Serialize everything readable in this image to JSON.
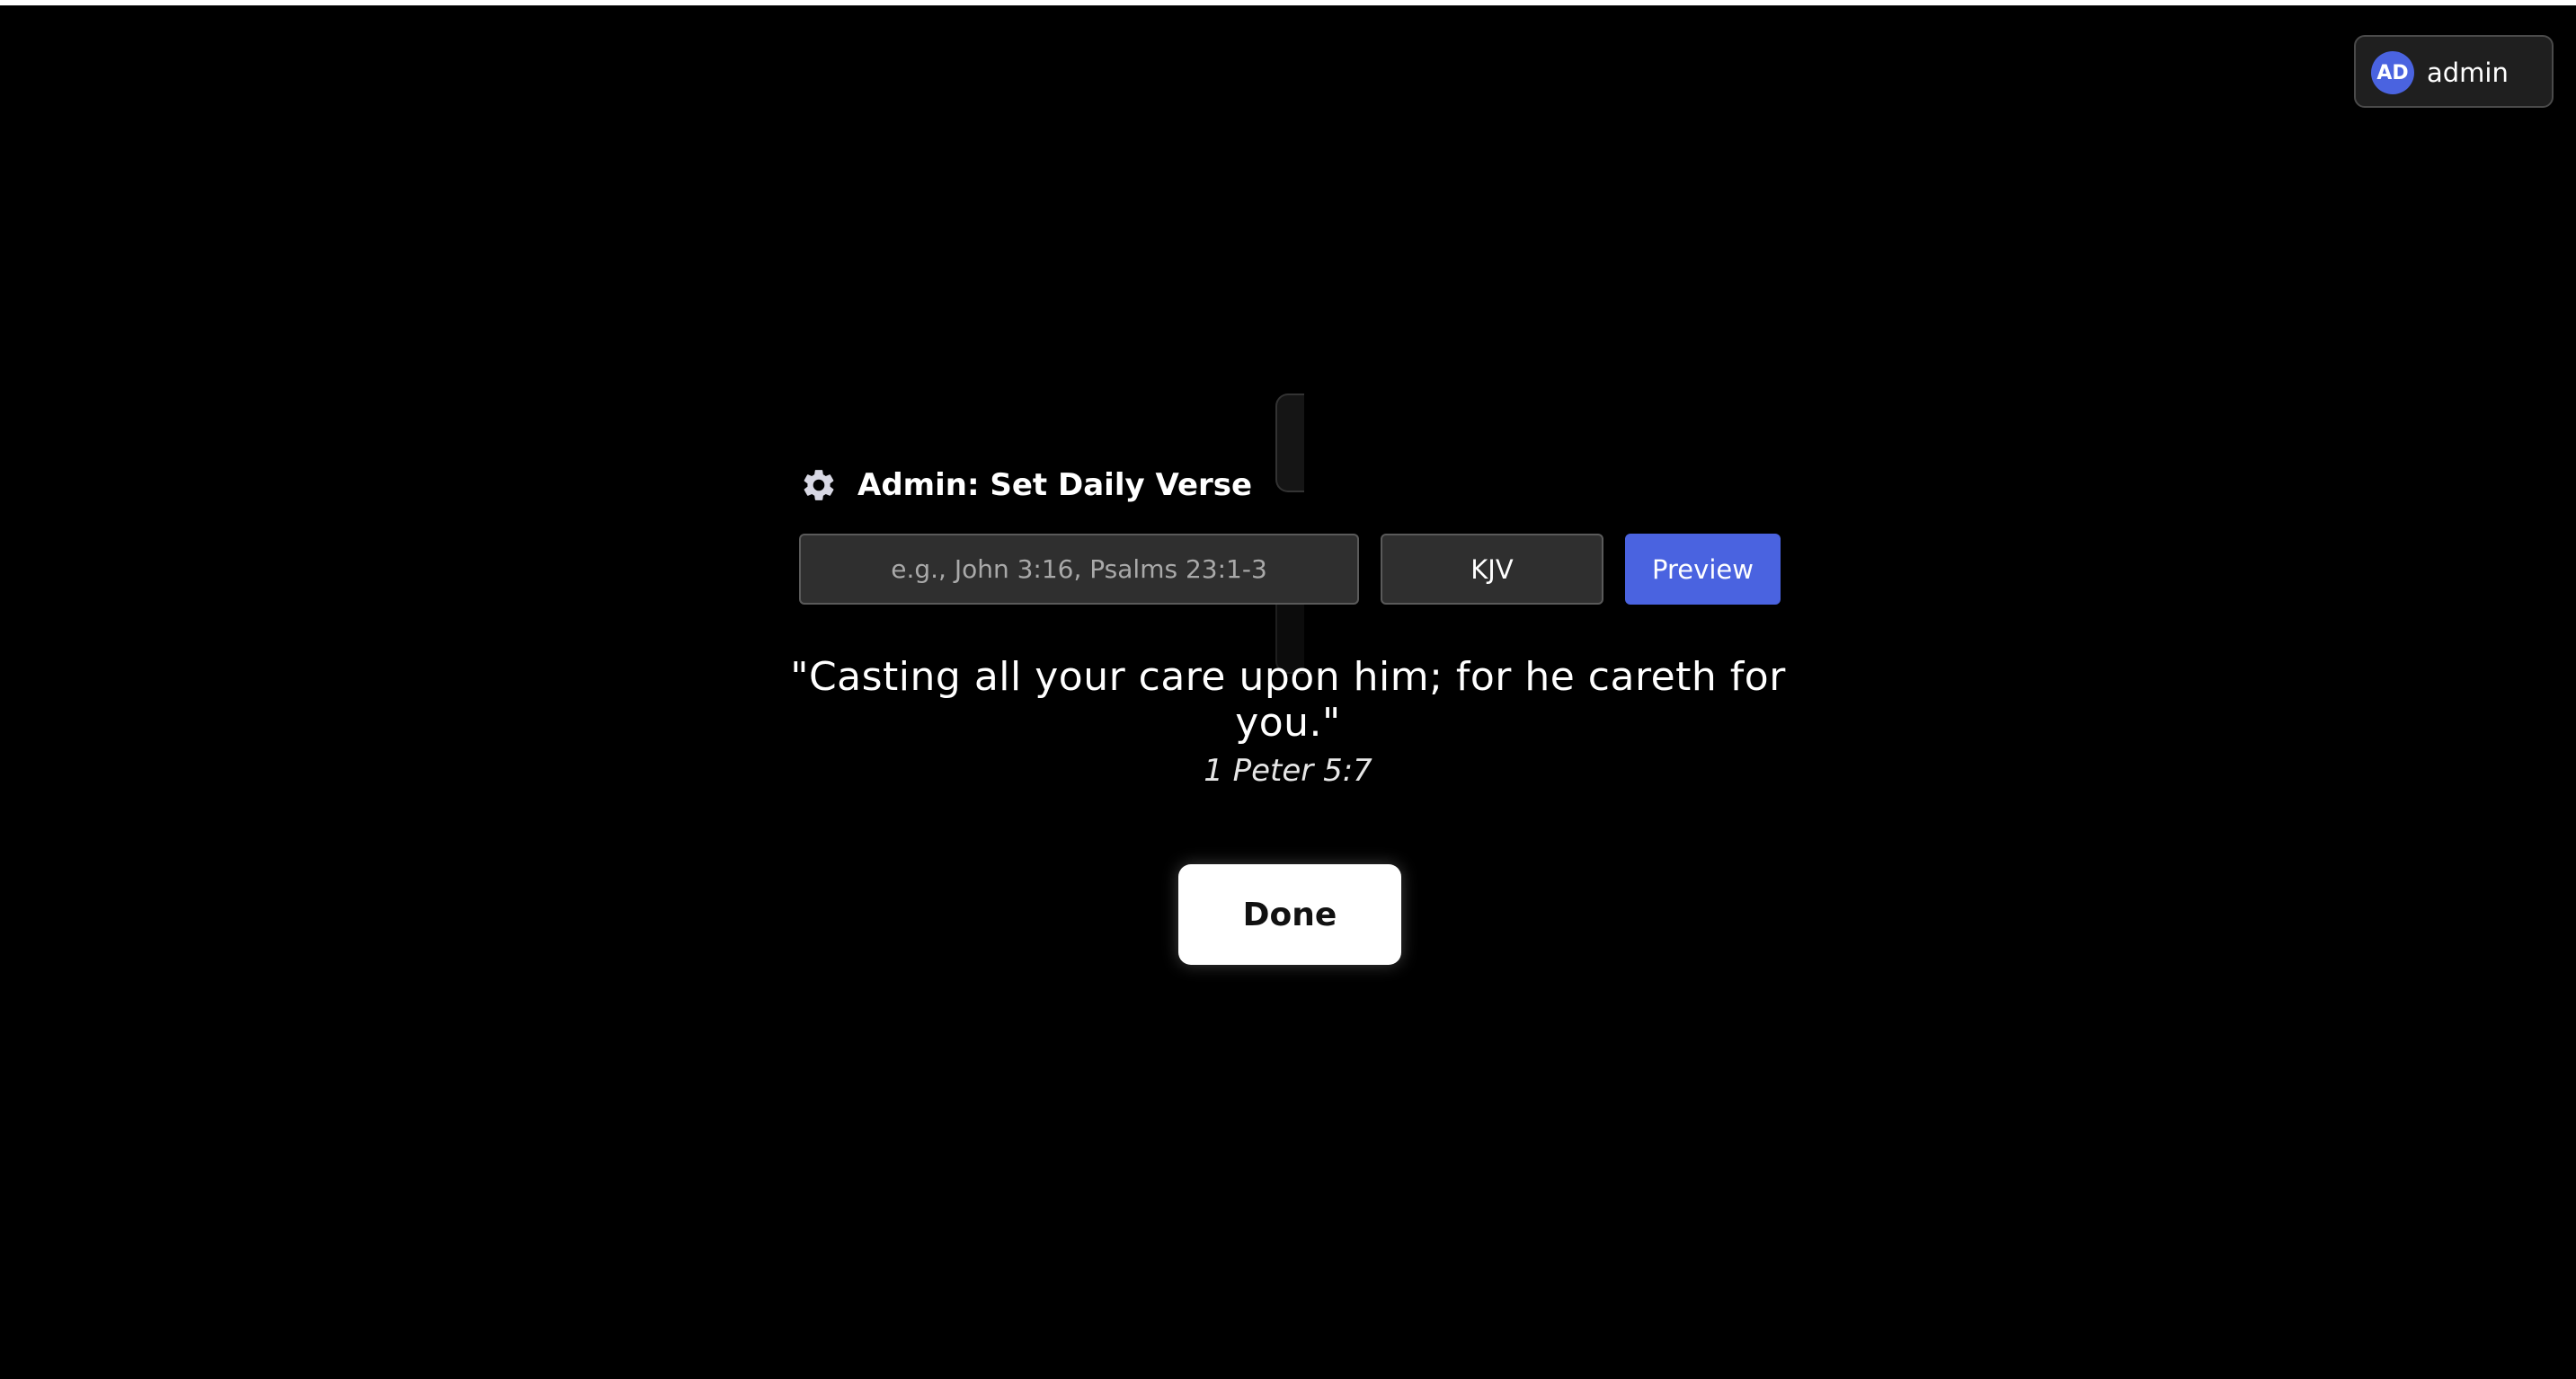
{
  "user": {
    "initials": "AD",
    "name": "admin"
  },
  "admin_panel": {
    "icon": "gear-icon",
    "title": "Admin: Set Daily Verse",
    "reference_input": {
      "value": "",
      "placeholder": "e.g., John 3:16, Psalms 23:1-3"
    },
    "translation": "KJV",
    "preview_label": "Preview"
  },
  "verse": {
    "text": "\"Casting all your care upon him; for he careth for you.\"",
    "reference": "1 Peter 5:7"
  },
  "done_label": "Done",
  "colors": {
    "background": "#000000",
    "accent": "#4a63e0",
    "field": "#2f2f2f"
  }
}
